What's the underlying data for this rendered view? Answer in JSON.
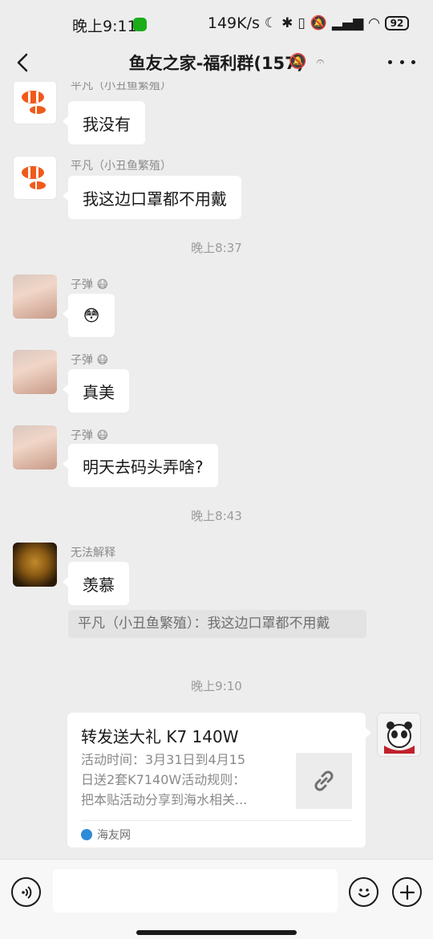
{
  "status_bar": {
    "time": "晚上9:11",
    "net_speed": "149K/s",
    "battery": "92"
  },
  "header": {
    "title": "鱼友之家-福利群(157)"
  },
  "messages": [
    {
      "sender": "平凡（小丑鱼繁殖）",
      "text": "我没有"
    },
    {
      "sender": "平凡（小丑鱼繁殖）",
      "text": "我这边口罩都不用戴"
    },
    {
      "sender": "子弹",
      "text": "😳"
    },
    {
      "sender": "子弹",
      "text": "真美"
    },
    {
      "sender": "子弹",
      "text": "明天去码头弄啥?"
    },
    {
      "sender": "无法解释",
      "text": "羡慕",
      "quote": "平凡（小丑鱼繁殖）：我这边口罩都不用戴"
    }
  ],
  "timestamps": [
    "晚上8:37",
    "晚上8:43",
    "晚上9:10"
  ],
  "share_card": {
    "title": "转发送大礼 K7 140W",
    "desc_line1": "活动时间：3月31日到4月15",
    "desc_line2": "日送2套K7140W活动规则：",
    "desc_line3": "把本贴活动分享到海水相关...",
    "source": "海友网"
  },
  "input": {
    "placeholder": ""
  }
}
